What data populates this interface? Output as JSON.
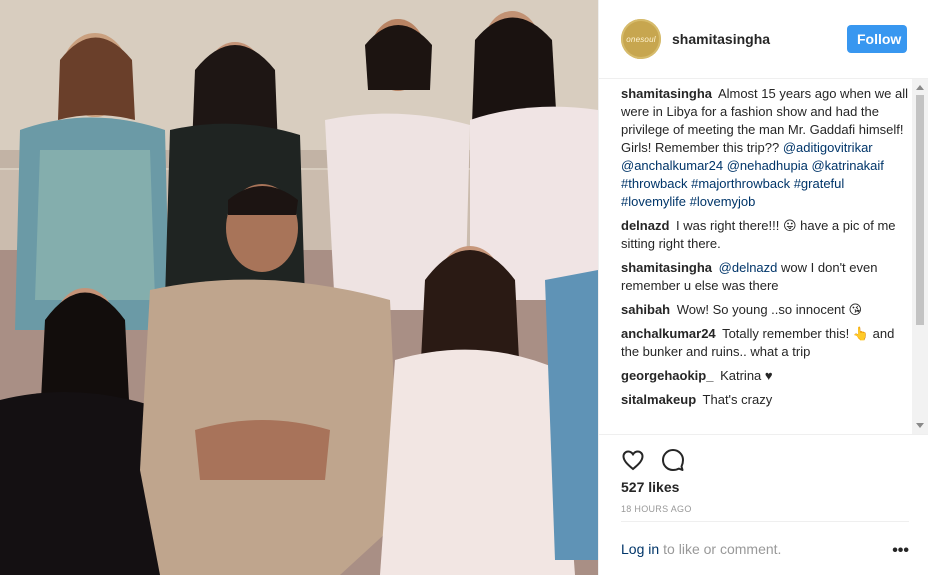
{
  "photo": {
    "alt": "Group photo of seven people"
  },
  "header": {
    "avatar_text": "onesoul",
    "username": "shamitasingha",
    "follow_label": "Follow"
  },
  "comments": [
    {
      "author": "shamitasingha",
      "text": "Almost 15 years ago when we all were in Libya for a fashion show and had the privilege of meeting the man Mr. Gaddafi himself! Girls! Remember this trip??",
      "links": "@aditigovitrikar @anchalkumar24 @nehadhupia @katrinakaif #throwback #majorthrowback #grateful #lovemylife #lovemyjob"
    },
    {
      "author": "delnazd",
      "text": "I was right there!!! 😛 have a pic of me sitting right there."
    },
    {
      "author": "shamitasingha",
      "mention": "@delnazd",
      "text": "wow I don't even remember u else was there"
    },
    {
      "author": "sahibah",
      "text": "Wow! So young ..so innocent 😘"
    },
    {
      "author": "anchalkumar24",
      "text": "Totally remember this! 👆 and the bunker and ruins.. what a trip"
    },
    {
      "author": "georgehaokip_",
      "text": "Katrina ♥"
    },
    {
      "author": "sitalmakeup",
      "text": "That's crazy"
    }
  ],
  "actions": {
    "like_icon": "heart-icon",
    "comment_icon": "comment-bubble-icon",
    "likes": "527 likes",
    "time": "18 HOURS AGO"
  },
  "footer": {
    "login_label": "Log in",
    "login_rest": "to like or comment.",
    "more_label": "•••"
  },
  "colors": {
    "follow": "#3897f0",
    "link": "#003569",
    "muted": "#999999",
    "avatar": "#c7a64f"
  }
}
